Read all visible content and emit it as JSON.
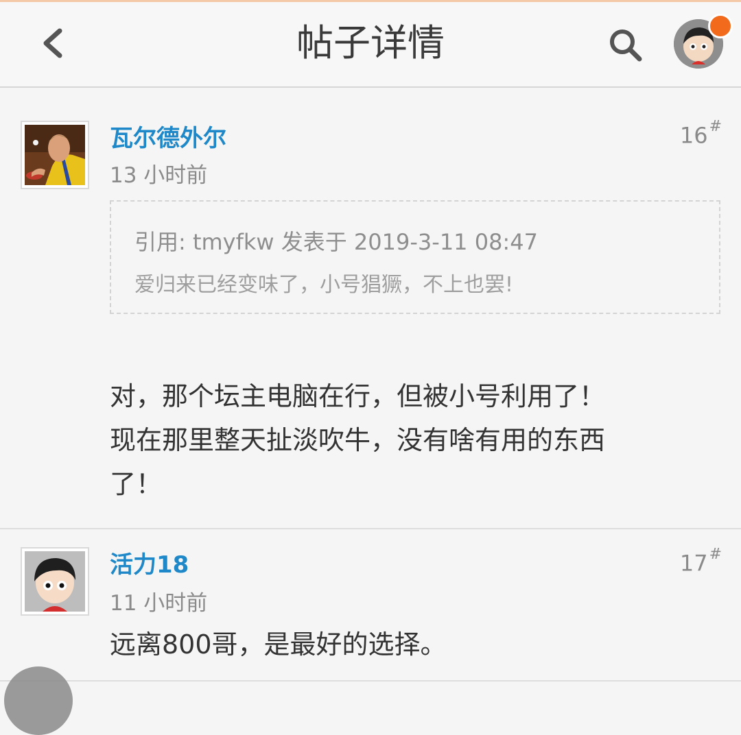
{
  "header": {
    "title": "帖子详情",
    "back_icon": "chevron-left-icon",
    "search_icon": "search-icon",
    "notification_color": "#f26b1d"
  },
  "posts": [
    {
      "author": "瓦尔德外尔",
      "time": "13 小时前",
      "floor": "16",
      "floor_mark": "#",
      "quote": {
        "header": "引用: tmyfkw 发表于 2019-3-11 08:47",
        "text": "爱归来已经变味了，小号猖獗，不上也罢!"
      },
      "body_lines": [
        "对，那个坛主电脑在行，但被小号利用了！",
        "现在那里整天扯淡吹牛，没有啥有用的东西",
        "了！"
      ]
    },
    {
      "author": "活力18",
      "time": "11 小时前",
      "floor": "17",
      "floor_mark": "#",
      "body": "远离800哥，是最好的选择。"
    }
  ],
  "colors": {
    "username": "#1e88c8",
    "meta": "#8a8a8a",
    "background": "#f5f5f5"
  }
}
